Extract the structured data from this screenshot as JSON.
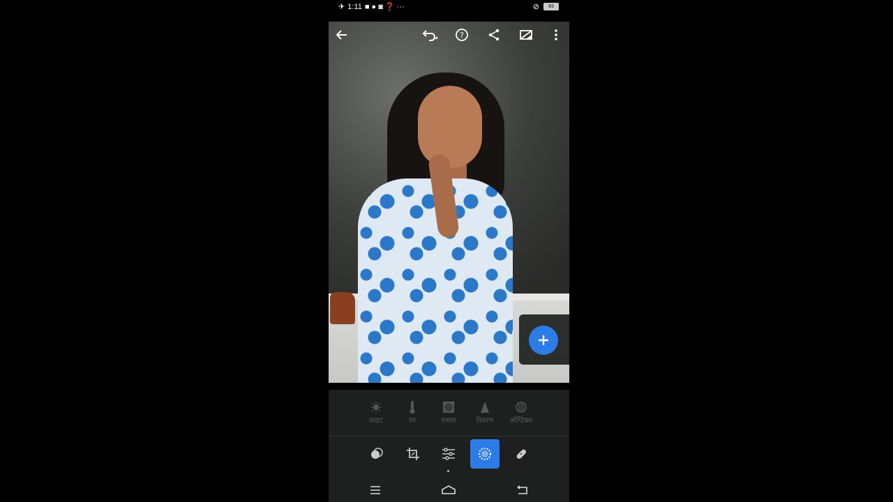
{
  "status_bar": {
    "time": "1:11",
    "battery": "83"
  },
  "toolbar": {
    "icons": [
      "back-arrow-icon",
      "undo-icon",
      "help-icon",
      "share-icon",
      "compare-icon",
      "more-icon"
    ]
  },
  "tools": [
    {
      "icon": "sun-icon",
      "label": "लाइट"
    },
    {
      "icon": "thermometer-icon",
      "label": "रंग"
    },
    {
      "icon": "vignette-icon",
      "label": "प्रभाव"
    },
    {
      "icon": "detail-icon",
      "label": "विवरण"
    },
    {
      "icon": "optics-icon",
      "label": "ऑप्टिक्स"
    }
  ],
  "modes": {
    "items": [
      "presets-icon",
      "crop-icon",
      "adjust-icon",
      "selective-icon",
      "healing-icon"
    ],
    "active_index": 3
  },
  "colors": {
    "accent": "#2d7be6",
    "panel": "#1e201f"
  }
}
